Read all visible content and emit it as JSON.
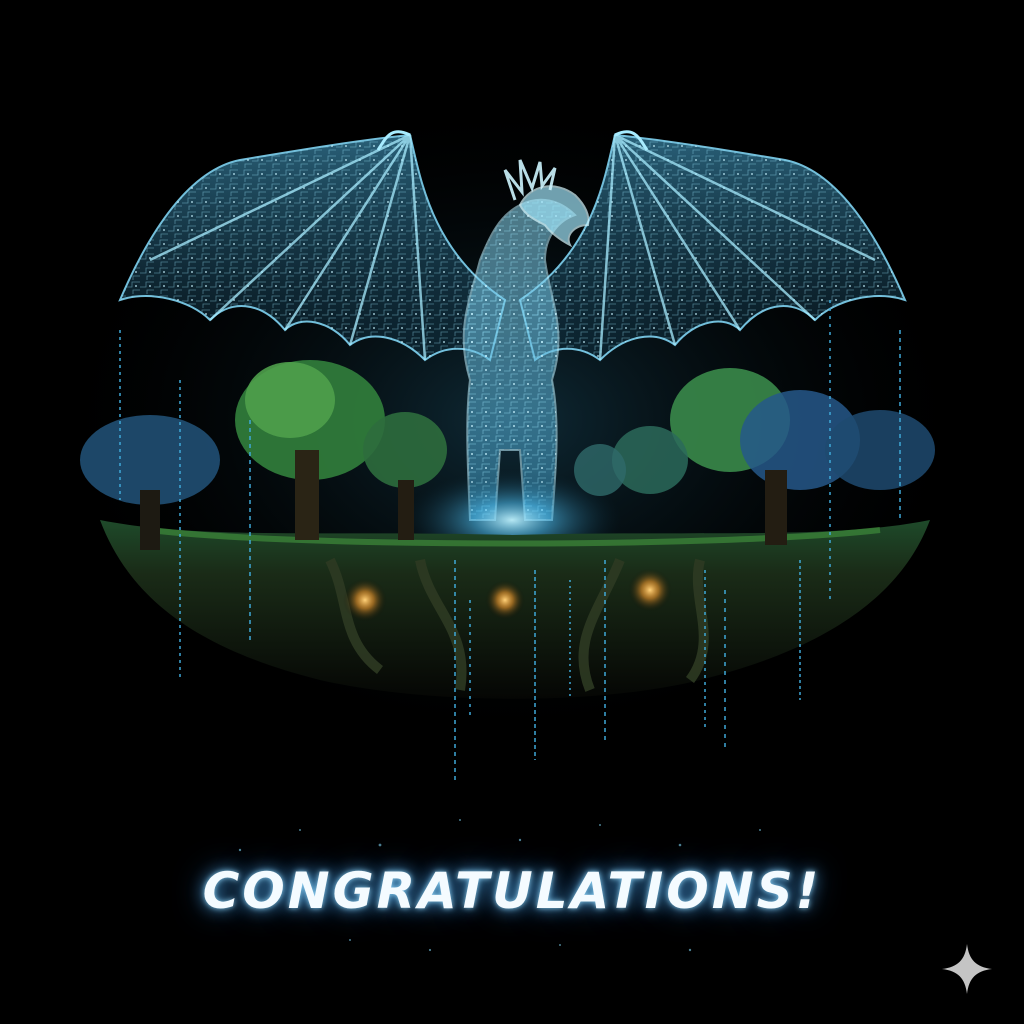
{
  "headline": {
    "text": "CONGRATULATIONS!"
  },
  "image": {
    "subject": "digital-dragon-over-enchanted-forest",
    "icon": "sparkle-icon"
  },
  "colors": {
    "background": "#000000",
    "dragon_glow": "#6fd6ff",
    "forest_green": "#2f7a3a",
    "lantern": "#ffb347",
    "code_rain": "#3fa9d8"
  }
}
